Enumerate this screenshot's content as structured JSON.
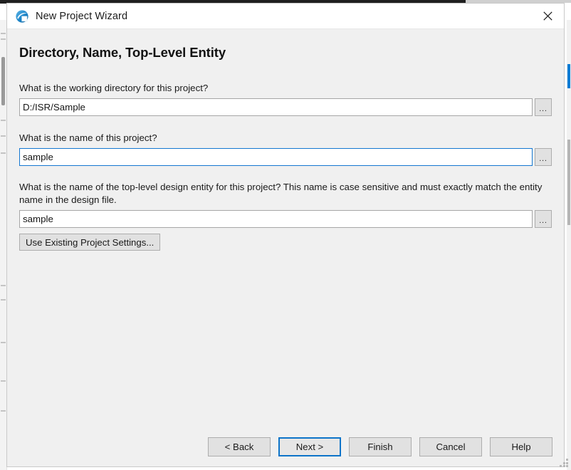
{
  "window": {
    "title": "New Project Wizard",
    "icon": "quartus-globe-icon",
    "close_label": "close-icon"
  },
  "page": {
    "heading": "Directory, Name, Top-Level Entity"
  },
  "fields": [
    {
      "question": "What is the working directory for this project?",
      "value": "D:/ISR/Sample",
      "placeholder": "",
      "browse_label": "...",
      "focused": false,
      "name": "working-directory"
    },
    {
      "question": "What is the name of this project?",
      "value": "sample",
      "placeholder": "",
      "browse_label": "...",
      "focused": true,
      "name": "project-name"
    },
    {
      "question": "What is the name of the top-level design entity for this project? This name is case sensitive and must exactly match the entity name in the design file.",
      "value": "sample",
      "placeholder": "",
      "browse_label": "...",
      "focused": false,
      "name": "top-level-entity"
    }
  ],
  "actions": {
    "use_existing_settings": "Use Existing Project Settings..."
  },
  "footer": {
    "buttons": [
      {
        "label": "< Back",
        "name": "back-button",
        "default": false
      },
      {
        "label": "Next >",
        "name": "next-button",
        "default": true
      },
      {
        "label": "Finish",
        "name": "finish-button",
        "default": false
      },
      {
        "label": "Cancel",
        "name": "cancel-button",
        "default": false
      },
      {
        "label": "Help",
        "name": "help-button",
        "default": false
      }
    ]
  },
  "colors": {
    "dialog_bg": "#f0f0f0",
    "titlebar_bg": "#ffffff",
    "accent_focus": "#1477d1",
    "default_button_border": "#0d74c9",
    "button_face": "#e1e1e1",
    "text": "#1a1a1a"
  }
}
